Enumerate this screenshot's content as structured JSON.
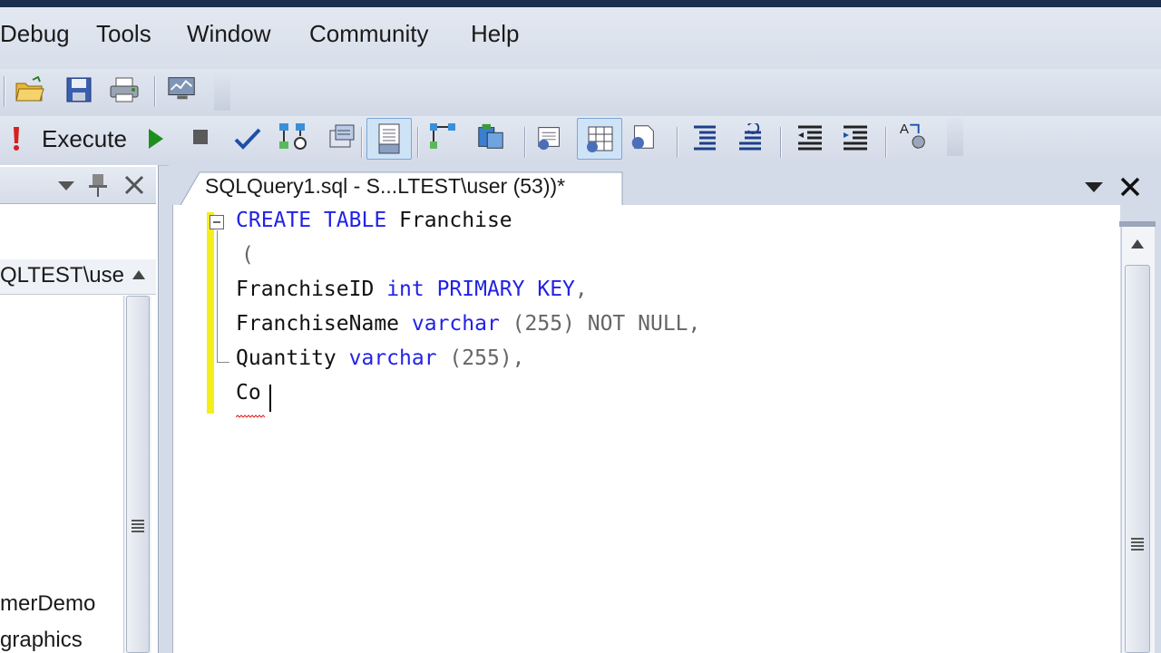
{
  "menu": {
    "items": [
      "Debug",
      "Tools",
      "Window",
      "Community",
      "Help"
    ]
  },
  "toolbar": {
    "execute_label": "Execute"
  },
  "left_panel": {
    "server_node": "QLTEST\\use",
    "db_items": [
      "merDemo",
      "graphics"
    ]
  },
  "editor": {
    "tab_title": "SQLQuery1.sql - S...LTEST\\user (53))*",
    "lines": {
      "l1_kw": "CREATE TABLE",
      "l1_name": " Franchise",
      "l2": "(",
      "l3_col": "FranchiseID",
      "l3_type": "int PRIMARY KEY",
      "l3_end": ",",
      "l4_col": "FranchiseName",
      "l4_type": "varchar",
      "l4_end": " (255) NOT NULL,",
      "l5_col": "Quantity",
      "l5_type": "varchar",
      "l5_end": " (255),",
      "l6": "Co"
    }
  },
  "icons": {
    "execute": "exclamation-icon",
    "debug": "play-icon",
    "stop": "stop-icon",
    "parse": "checkmark-icon",
    "close": "close-icon"
  },
  "colors": {
    "keyword": "#2222e6",
    "margin_change": "#f5ee19",
    "execute_icon": "#d62020",
    "play_icon": "#1d8f1d"
  }
}
